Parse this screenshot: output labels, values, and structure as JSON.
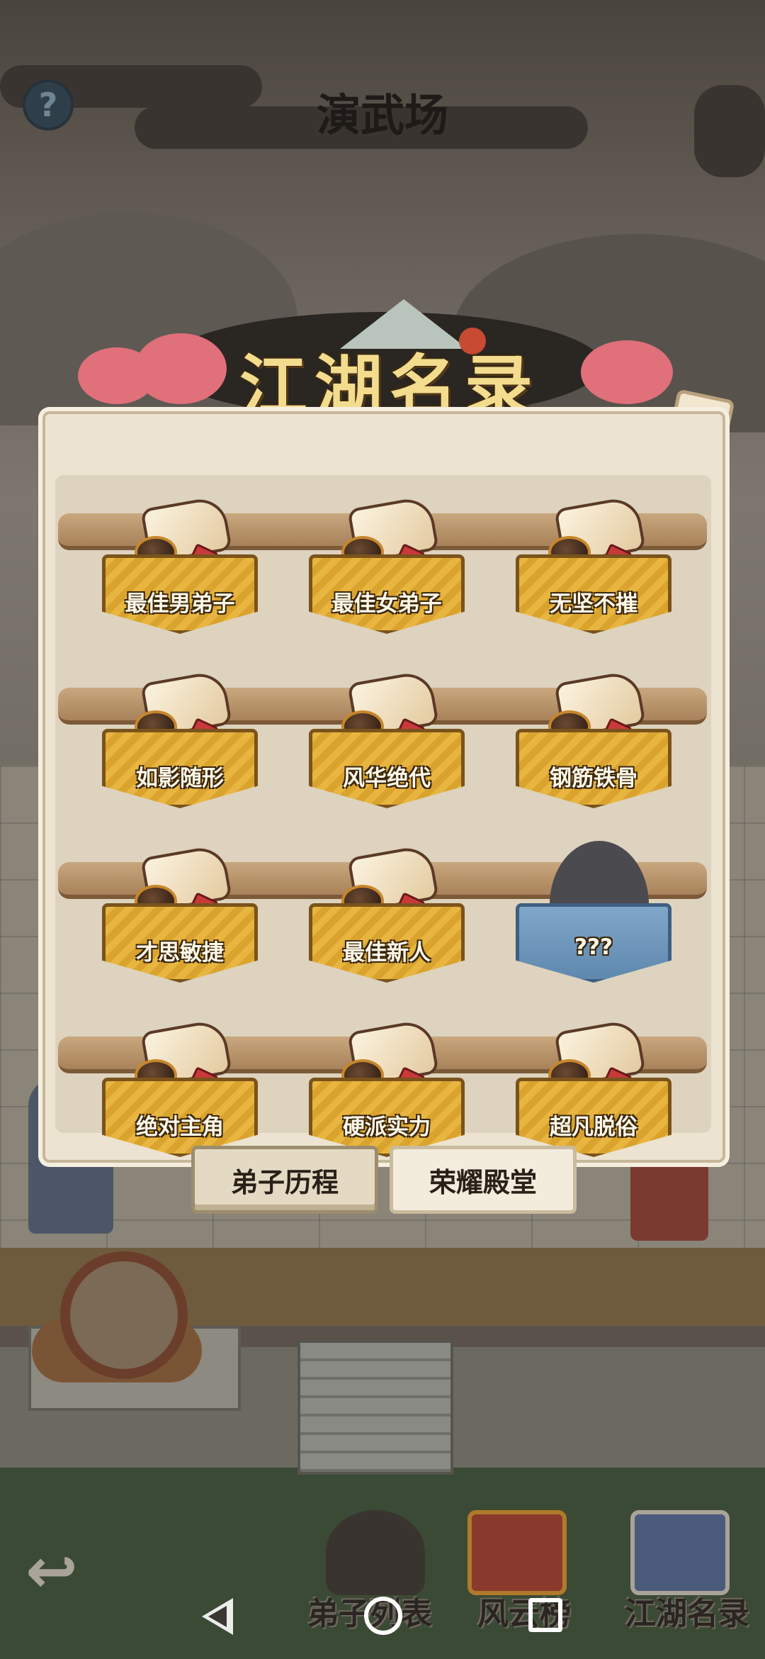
{
  "header": {
    "title": "演武场",
    "help_icon": "question-mark-icon"
  },
  "modal": {
    "title": "江湖名录",
    "close_icon": "close-x-icon",
    "awards": [
      {
        "label": "最佳男弟子",
        "locked": false
      },
      {
        "label": "最佳女弟子",
        "locked": false
      },
      {
        "label": "无坚不摧",
        "locked": false
      },
      {
        "label": "如影随形",
        "locked": false
      },
      {
        "label": "风华绝代",
        "locked": false
      },
      {
        "label": "钢筋铁骨",
        "locked": false
      },
      {
        "label": "才思敏捷",
        "locked": false
      },
      {
        "label": "最佳新人",
        "locked": false
      },
      {
        "label": "???",
        "locked": true
      },
      {
        "label": "绝对主角",
        "locked": false
      },
      {
        "label": "硬派实力",
        "locked": false
      },
      {
        "label": "超凡脱俗",
        "locked": false
      }
    ],
    "tabs": [
      {
        "label": "弟子历程",
        "active": true
      },
      {
        "label": "荣耀殿堂",
        "active": false
      }
    ]
  },
  "bottom_nav": {
    "back_icon": "back-arrow-icon",
    "items": [
      {
        "label": "弟子列表",
        "icon": "disciple-avatar-icon"
      },
      {
        "label": "风云榜",
        "icon": "ranking-scroll-icon"
      },
      {
        "label": "江湖名录",
        "icon": "book-icon"
      }
    ]
  },
  "system_nav": {
    "back": "system-back-icon",
    "home": "system-home-icon",
    "recents": "system-recents-icon"
  },
  "colors": {
    "plaque_gold": "#e8b640",
    "locked_blue": "#7fa7c9",
    "panel_bg": "#ece3d1",
    "title_gold": "#f4dc8e"
  }
}
